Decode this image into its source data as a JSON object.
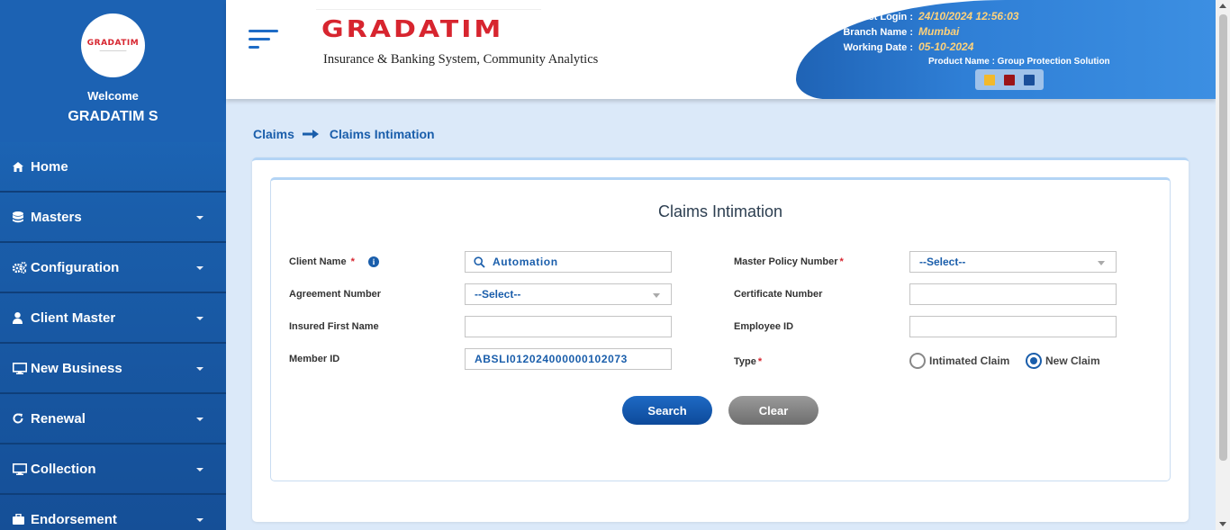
{
  "sidebar": {
    "logo_text": "GRADATIM",
    "welcome": "Welcome",
    "username": "GRADATIM S",
    "items": [
      {
        "label": "Home",
        "icon": "home-icon",
        "has_caret": false
      },
      {
        "label": "Masters",
        "icon": "database-icon",
        "has_caret": true
      },
      {
        "label": "Configuration",
        "icon": "gears-icon",
        "has_caret": true
      },
      {
        "label": "Client Master",
        "icon": "user-icon",
        "has_caret": true
      },
      {
        "label": "New Business",
        "icon": "desktop-icon",
        "has_caret": true
      },
      {
        "label": "Renewal",
        "icon": "refresh-icon",
        "has_caret": true
      },
      {
        "label": "Collection",
        "icon": "desktop-icon",
        "has_caret": true
      },
      {
        "label": "Endorsement",
        "icon": "briefcase-icon",
        "has_caret": true
      }
    ]
  },
  "header": {
    "brand_name": "GRADATIM",
    "brand_tagline": "Insurance & Banking System, Community Analytics",
    "last_login_label": "Last Login :",
    "last_login_value": "24/10/2024 12:56:03",
    "branch_label": "Branch Name :",
    "branch_value": "Mumbai",
    "working_date_label": "Working Date :",
    "working_date_value": "05-10-2024",
    "product": "Product Name : Group Protection Solution",
    "theme_colors": [
      "#f2b92c",
      "#9b1418",
      "#1a4f9a"
    ]
  },
  "breadcrumb": {
    "parent": "Claims",
    "current": "Claims Intimation"
  },
  "form": {
    "title": "Claims Intimation",
    "client_name_label": "Client Name",
    "client_name_value": "Automation",
    "master_policy_label": "Master Policy Number",
    "master_policy_value": "--Select--",
    "agreement_label": "Agreement Number",
    "agreement_value": "--Select--",
    "certificate_label": "Certificate Number",
    "certificate_value": "",
    "insured_first_name_label": "Insured First Name",
    "insured_first_name_value": "",
    "employee_id_label": "Employee ID",
    "employee_id_value": "",
    "member_id_label": "Member ID",
    "member_id_value": "ABSLI012024000000102073",
    "type_label": "Type",
    "type_options": [
      "Intimated Claim",
      "New Claim"
    ],
    "type_selected": "New Claim",
    "required_mark": "*",
    "search_button": "Search",
    "clear_button": "Clear"
  },
  "colors": {
    "primary": "#1a5eab",
    "required": "#d7252f",
    "accent_date": "#ffd27a"
  }
}
